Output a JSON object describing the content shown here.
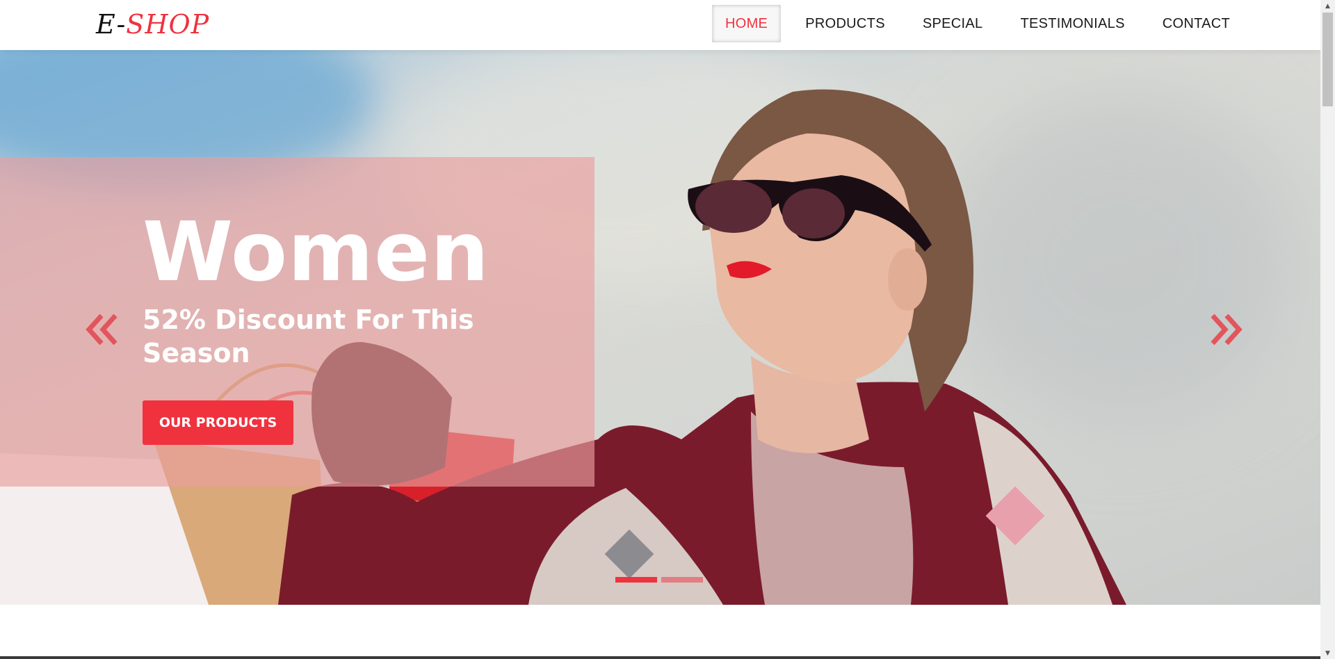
{
  "brand": {
    "logo_part1": "E-",
    "logo_part2": "SHOP"
  },
  "nav": {
    "items": [
      {
        "label": "HOME",
        "active": true
      },
      {
        "label": "PRODUCTS",
        "active": false
      },
      {
        "label": "SPECIAL",
        "active": false
      },
      {
        "label": "TESTIMONIALS",
        "active": false
      },
      {
        "label": "CONTACT",
        "active": false
      }
    ]
  },
  "hero": {
    "title": "Women",
    "subtitle": "52% Discount For This Season",
    "cta_label": "OUR PRODUCTS",
    "prev_icon": "double-chevron-left-icon",
    "next_icon": "double-chevron-right-icon",
    "slide_count": 2,
    "active_slide": 1
  },
  "colors": {
    "accent": "#f0323f",
    "panel_overlay": "#e99e9e",
    "text_dark": "#1a1a1a"
  }
}
